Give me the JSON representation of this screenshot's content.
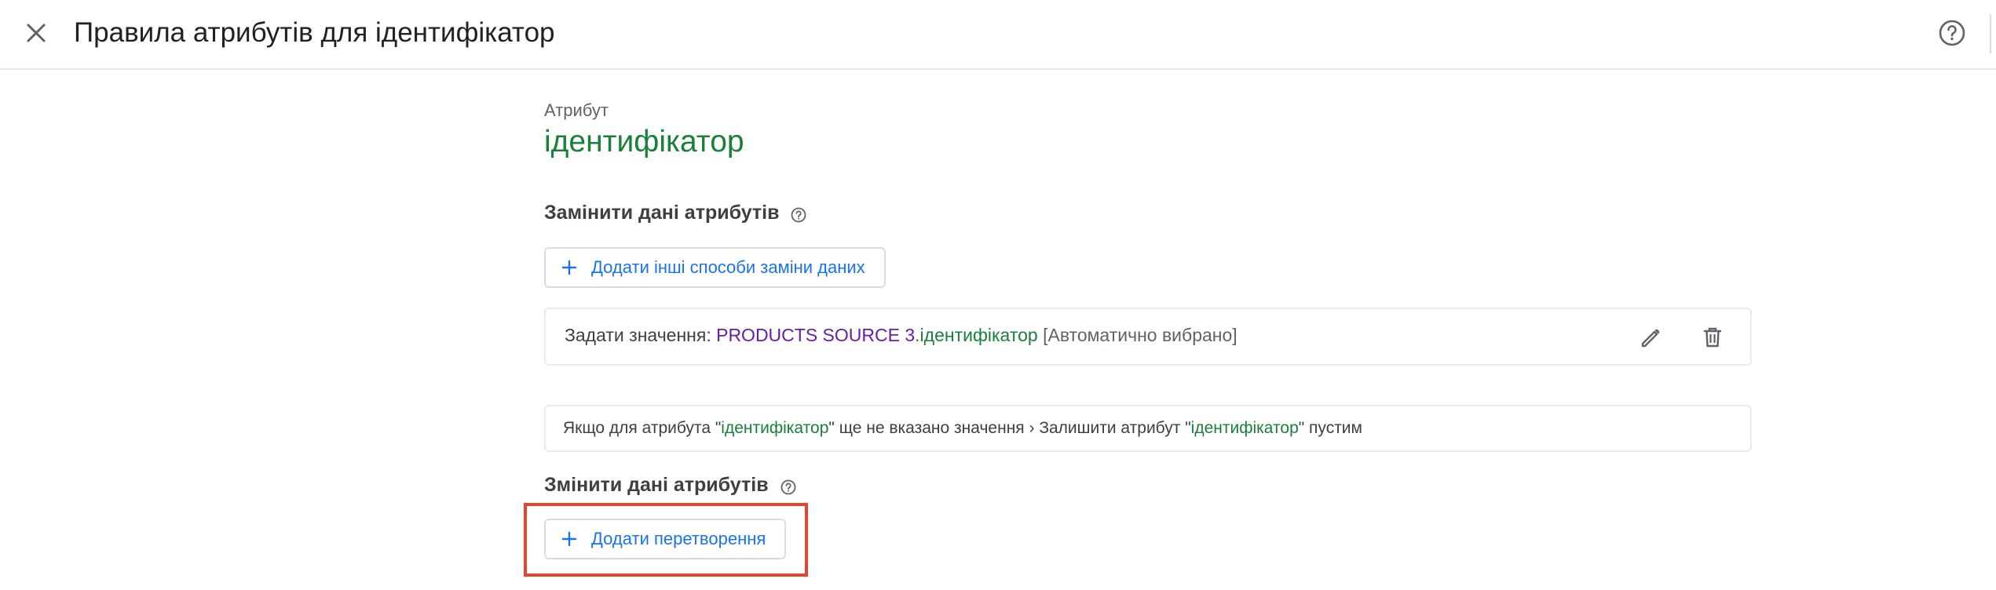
{
  "header": {
    "title": "Правила атрибутів для ідентифікатор"
  },
  "attribute": {
    "caption": "Атрибут",
    "name": "ідентифікатор"
  },
  "replace_section": {
    "title": "Замінити дані атрибутів",
    "add_button_label": "Додати інші способи заміни даних",
    "rule": {
      "prefix": "Задати значення: ",
      "source": "PRODUCTS SOURCE 3",
      "dot": ".",
      "field": "ідентифікатор",
      "note": " [Автоматично вибрано]"
    }
  },
  "fallback": {
    "part1": "Якщо для атрибута \"",
    "attr1": "ідентифікатор",
    "part2": "\" ще не вказано значення › Залишити атрибут \"",
    "attr2": "ідентифікатор",
    "part3": "\" пустим"
  },
  "modify_section": {
    "title": "Змінити дані атрибутів",
    "add_button_label": "Додати перетворення"
  },
  "colors": {
    "accent_blue": "#1a73e8",
    "attribute_green": "#188038",
    "source_purple": "#681da8",
    "highlight_red": "#e8452c"
  },
  "icons": [
    "close-icon",
    "help-icon",
    "plus-icon",
    "edit-icon",
    "delete-icon"
  ]
}
